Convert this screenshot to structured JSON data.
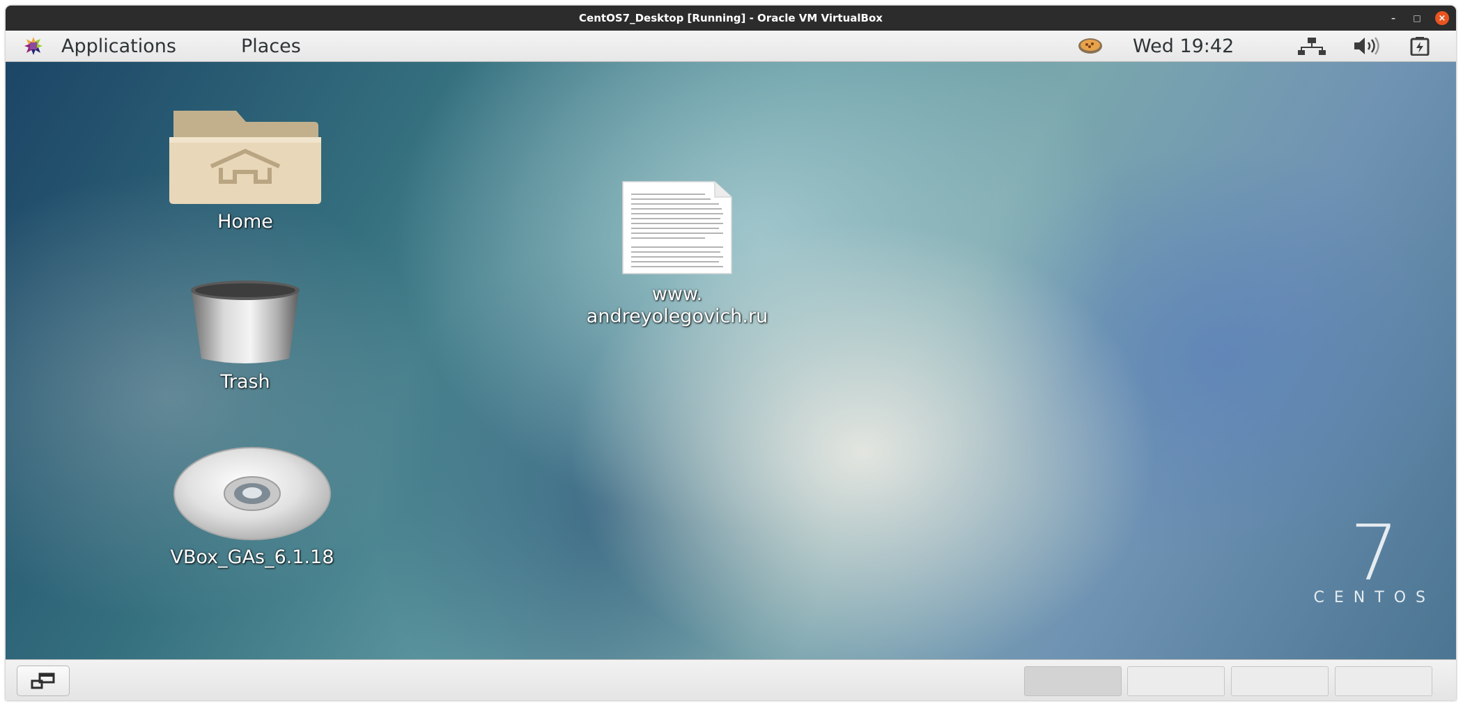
{
  "host_window": {
    "title": "CentOS7_Desktop [Running] - Oracle VM VirtualBox",
    "controls": {
      "minimize": "–",
      "maximize": "□",
      "close": "×"
    }
  },
  "topbar": {
    "applications": "Applications",
    "places": "Places",
    "clock": "Wed 19:42",
    "icons": [
      "gnome-logo-icon",
      "pie-status-icon",
      "network-icon",
      "volume-icon",
      "battery-icon"
    ]
  },
  "desktop": {
    "icons": [
      {
        "label": "Home",
        "icon": "home-folder-icon"
      },
      {
        "label": "Trash",
        "icon": "trash-icon"
      },
      {
        "label": "VBox_GAs_6.1.18",
        "icon": "cdrom-icon"
      },
      {
        "label_line1": "www.",
        "label_line2": "andreyolegovich.ru",
        "icon": "text-document-icon"
      }
    ],
    "logo": {
      "number": "7",
      "word": "CENTOS"
    }
  },
  "bottombar": {
    "workspaces": [
      {
        "active": true
      },
      {
        "active": false
      },
      {
        "active": false
      },
      {
        "active": false
      }
    ]
  }
}
